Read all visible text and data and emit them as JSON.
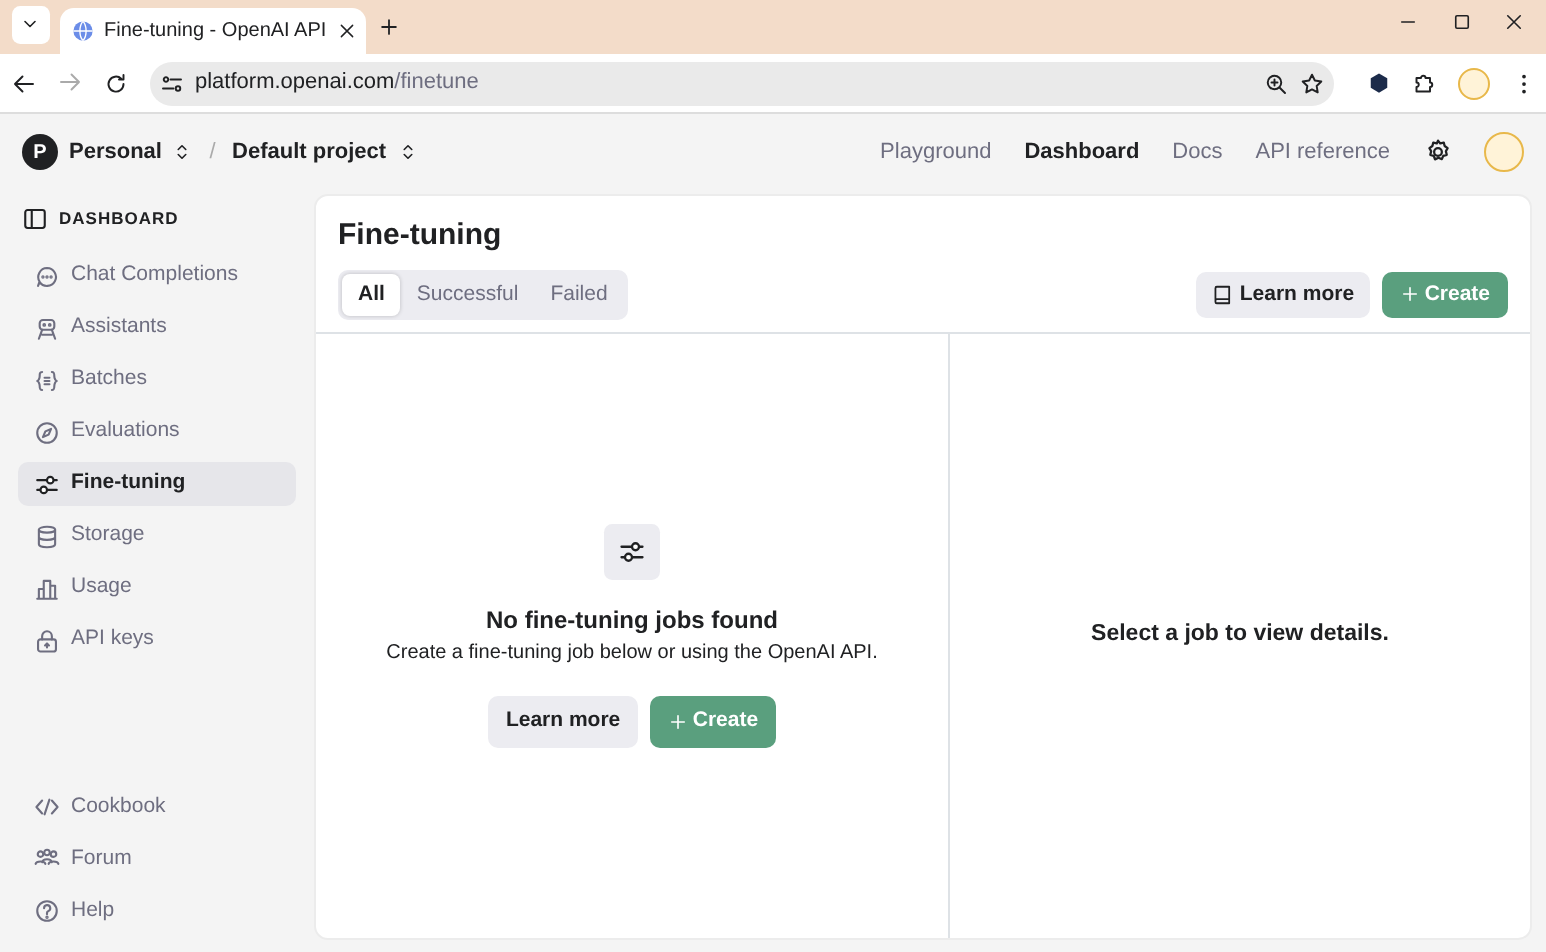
{
  "browser": {
    "tab_title": "Fine-tuning - OpenAI API",
    "url_host": "platform.openai.com",
    "url_path": "/finetune"
  },
  "header": {
    "org_initial": "P",
    "org": "Personal",
    "project": "Default project",
    "separator": "/",
    "nav": [
      {
        "label": "Playground",
        "selected": false
      },
      {
        "label": "Dashboard",
        "selected": true
      },
      {
        "label": "Docs",
        "selected": false
      },
      {
        "label": "API reference",
        "selected": false
      }
    ]
  },
  "sidebar": {
    "heading": "DASHBOARD",
    "items": [
      {
        "label": "Chat Completions",
        "selected": false
      },
      {
        "label": "Assistants",
        "selected": false
      },
      {
        "label": "Batches",
        "selected": false
      },
      {
        "label": "Evaluations",
        "selected": false
      },
      {
        "label": "Fine-tuning",
        "selected": true
      },
      {
        "label": "Storage",
        "selected": false
      },
      {
        "label": "Usage",
        "selected": false
      },
      {
        "label": "API keys",
        "selected": false
      }
    ],
    "footer_items": [
      {
        "label": "Cookbook"
      },
      {
        "label": "Forum"
      },
      {
        "label": "Help"
      }
    ]
  },
  "main": {
    "title": "Fine-tuning",
    "filters": [
      {
        "label": "All",
        "selected": true
      },
      {
        "label": "Successful",
        "selected": false
      },
      {
        "label": "Failed",
        "selected": false
      }
    ],
    "learn_more": "Learn more",
    "create": "Create",
    "empty": {
      "title": "No fine-tuning jobs found",
      "text": "Create a fine-tuning job below or using the OpenAI API.",
      "learn_more": "Learn more",
      "create": "Create"
    },
    "detail_message": "Select a job to view details."
  }
}
